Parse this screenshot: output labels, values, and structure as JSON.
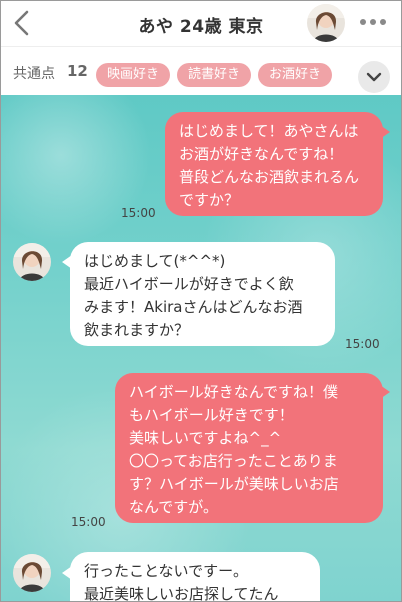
{
  "header": {
    "title": "あや 24歳 東京"
  },
  "common": {
    "label": "共通点",
    "count": "12",
    "tags": [
      "映画好き",
      "読書好き",
      "お酒好き"
    ]
  },
  "messages": [
    {
      "direction": "sent",
      "lines": [
        "はじめまして！あやさんは",
        "お酒が好きなんですね！",
        "普段どんなお酒飲まれるん",
        "ですか？"
      ],
      "time": "15:00"
    },
    {
      "direction": "received",
      "lines": [
        "はじめまして(*^^*)",
        "最近ハイボールが好きでよく飲",
        "みます！Akiraさんはどんなお酒",
        "飲まれますか？"
      ],
      "time": "15:00"
    },
    {
      "direction": "sent",
      "lines": [
        "ハイボール好きなんですね！僕",
        "もハイボール好きです！",
        "美味しいですよね^_^",
        "〇〇ってお店行ったことありま",
        "す？ハイボールが美味しいお店",
        "なんですが。"
      ],
      "time": "15:00"
    },
    {
      "direction": "received",
      "lines": [
        "行ったことないですー。",
        "最近美味しいお店探してたん"
      ],
      "time": ""
    }
  ],
  "icons": {
    "back": "chevron-left-icon",
    "more": "more-dots-icon",
    "expand": "chevron-down-icon"
  },
  "colors": {
    "sent_bubble": "#f2737a",
    "tag": "#f0a3a7",
    "chat_bg": "#74d1cc"
  }
}
